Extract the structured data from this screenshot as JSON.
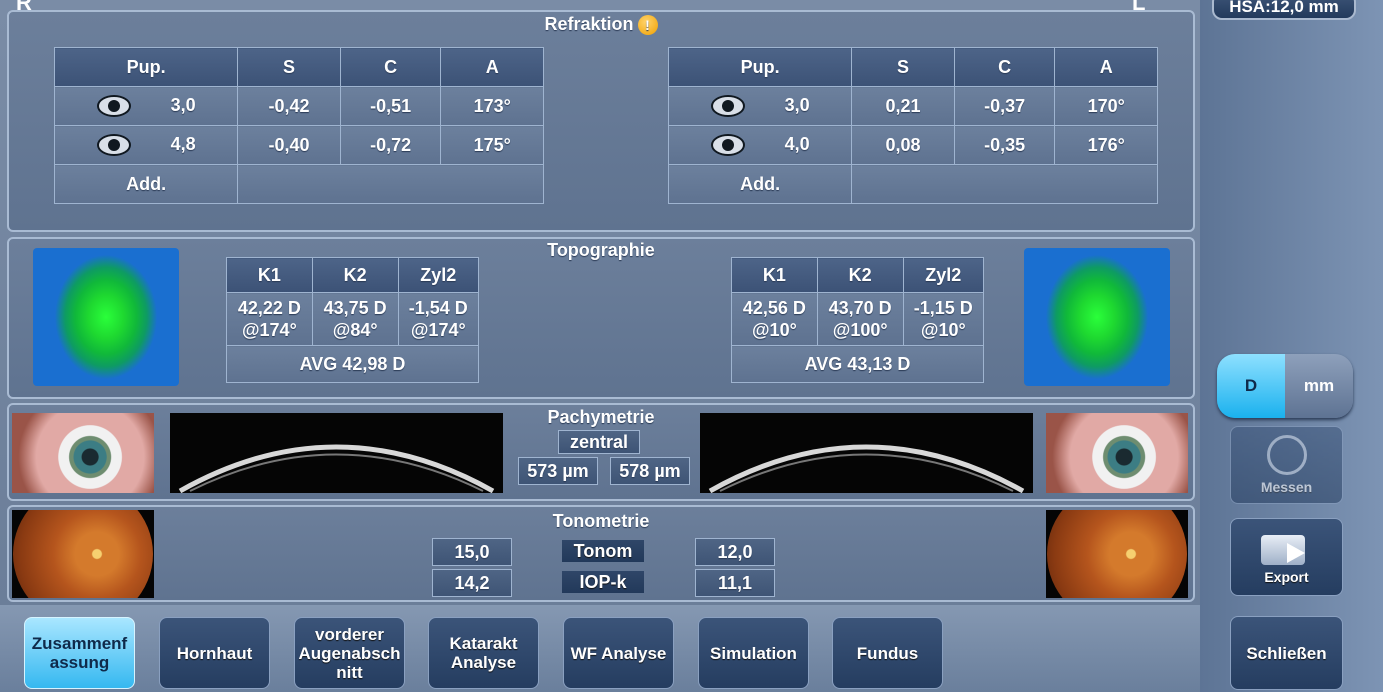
{
  "header": {
    "left_mark": "R",
    "right_mark": "L",
    "hsa": "HSA:12,0 mm"
  },
  "refraktion": {
    "title": "Refraktion",
    "warning_icon": "warning-icon",
    "columns": [
      "Pup.",
      "S",
      "C",
      "A"
    ],
    "right_eye": {
      "rows": [
        {
          "pup": "3,0",
          "s": "-0,42",
          "c": "-0,51",
          "a": "173°"
        },
        {
          "pup": "4,8",
          "s": "-0,40",
          "c": "-0,72",
          "a": "175°"
        }
      ],
      "add_label": "Add.",
      "add_value": ""
    },
    "left_eye": {
      "rows": [
        {
          "pup": "3,0",
          "s": "0,21",
          "c": "-0,37",
          "a": "170°"
        },
        {
          "pup": "4,0",
          "s": "0,08",
          "c": "-0,35",
          "a": "176°"
        }
      ],
      "add_label": "Add.",
      "add_value": ""
    }
  },
  "topographie": {
    "title": "Topographie",
    "columns": [
      "K1",
      "K2",
      "Zyl2"
    ],
    "right_eye": {
      "k1": "42,22 D",
      "k1_axis": "@174°",
      "k2": "43,75 D",
      "k2_axis": "@84°",
      "zyl2": "-1,54 D",
      "zyl2_axis": "@174°",
      "avg": "AVG 42,98 D"
    },
    "left_eye": {
      "k1": "42,56 D",
      "k1_axis": "@10°",
      "k2": "43,70 D",
      "k2_axis": "@100°",
      "zyl2": "-1,15 D",
      "zyl2_axis": "@10°",
      "avg": "AVG 43,13 D"
    }
  },
  "pachymetrie": {
    "title": "Pachymetrie",
    "subtitle": "zentral",
    "right_value": "573 µm",
    "left_value": "578 µm"
  },
  "tonometrie": {
    "title": "Tonometrie",
    "rows": [
      {
        "label": "Tonom",
        "right": "15,0",
        "left": "12,0"
      },
      {
        "label": "IOP-k",
        "right": "14,2",
        "left": "11,1"
      }
    ]
  },
  "tabs": [
    {
      "label": "Zusammenf assung",
      "active": true
    },
    {
      "label": "Hornhaut"
    },
    {
      "label": "vorderer Augenabsch nitt"
    },
    {
      "label": "Katarakt Analyse"
    },
    {
      "label": "WF Analyse"
    },
    {
      "label": "Simulation"
    },
    {
      "label": "Fundus"
    }
  ],
  "sidebar": {
    "unit_d": "D",
    "unit_mm": "mm",
    "messen": "Messen",
    "export": "Export",
    "schliessen": "Schließen"
  },
  "colors": {
    "accent": "#35b8f0",
    "panel": "#6c7f9b",
    "border": "#a9bbd3",
    "warning": "#f0a000"
  }
}
